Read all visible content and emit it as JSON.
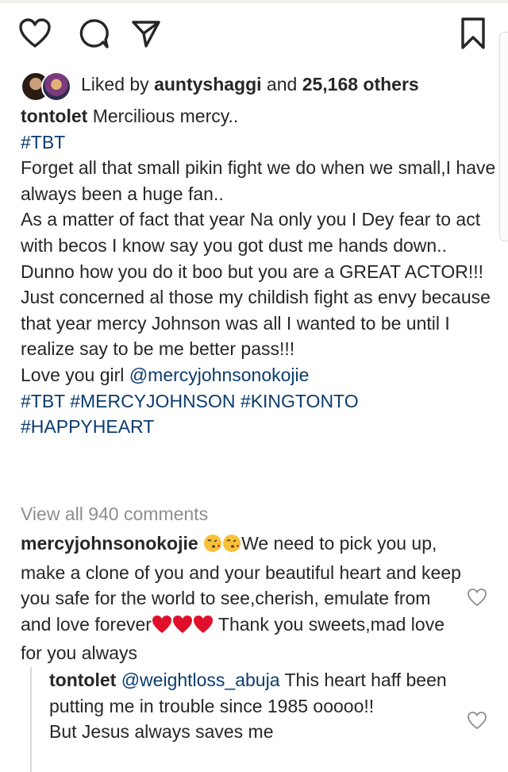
{
  "actions": {
    "like_icon": "heart-outline-icon",
    "comment_icon": "comment-icon",
    "share_icon": "share-paper-plane-icon",
    "save_icon": "bookmark-icon"
  },
  "likes": {
    "prefix": "Liked by ",
    "user": "auntyshaggi",
    "middle": " and ",
    "others": "25,168 others"
  },
  "caption": {
    "username": "tontolet",
    "title": " Mercilious mercy..",
    "tag_tbt": "#TBT",
    "body_1": "Forget all that small pikin fight we do when we small,I have always been a huge fan..",
    "body_2": "As a matter of fact that year Na only you I Dey fear to act with becos I know say you got dust me hands down..",
    "body_3": "Dunno how you do it boo but you are a GREAT ACTOR!!!",
    "body_4": "Just concerned al those my childish fight as envy because that year mercy Johnson was all I wanted to be until I realize say to be me better pass!!!",
    "love_prefix": "Love you girl ",
    "love_mention": "@mercyjohnsonokojie",
    "hashtags_line": "#TBT #MERCYJOHNSON #KINGTONTO",
    "hashtag_last": "#HAPPYHEART"
  },
  "view_all": "View all 940 comments",
  "comments": [
    {
      "username": "mercyjohnsonokojie",
      "text_a": "We need to pick you up, make a clone of you and your beautiful heart and keep you safe for the world to see,cherish, emulate from and love forever",
      "text_b": " Thank you sweets,mad love for you always"
    }
  ],
  "reply": {
    "username": "tontolet",
    "mention": "@weightloss_abuja",
    "text_1": " This heart haff been putting me in trouble since 1985 ooooo!!",
    "text_2": "But Jesus always saves me"
  },
  "colors": {
    "text": "#262626",
    "link": "#0b3b6e",
    "muted": "#8e8e8e",
    "heart_red": "#e0102a"
  }
}
